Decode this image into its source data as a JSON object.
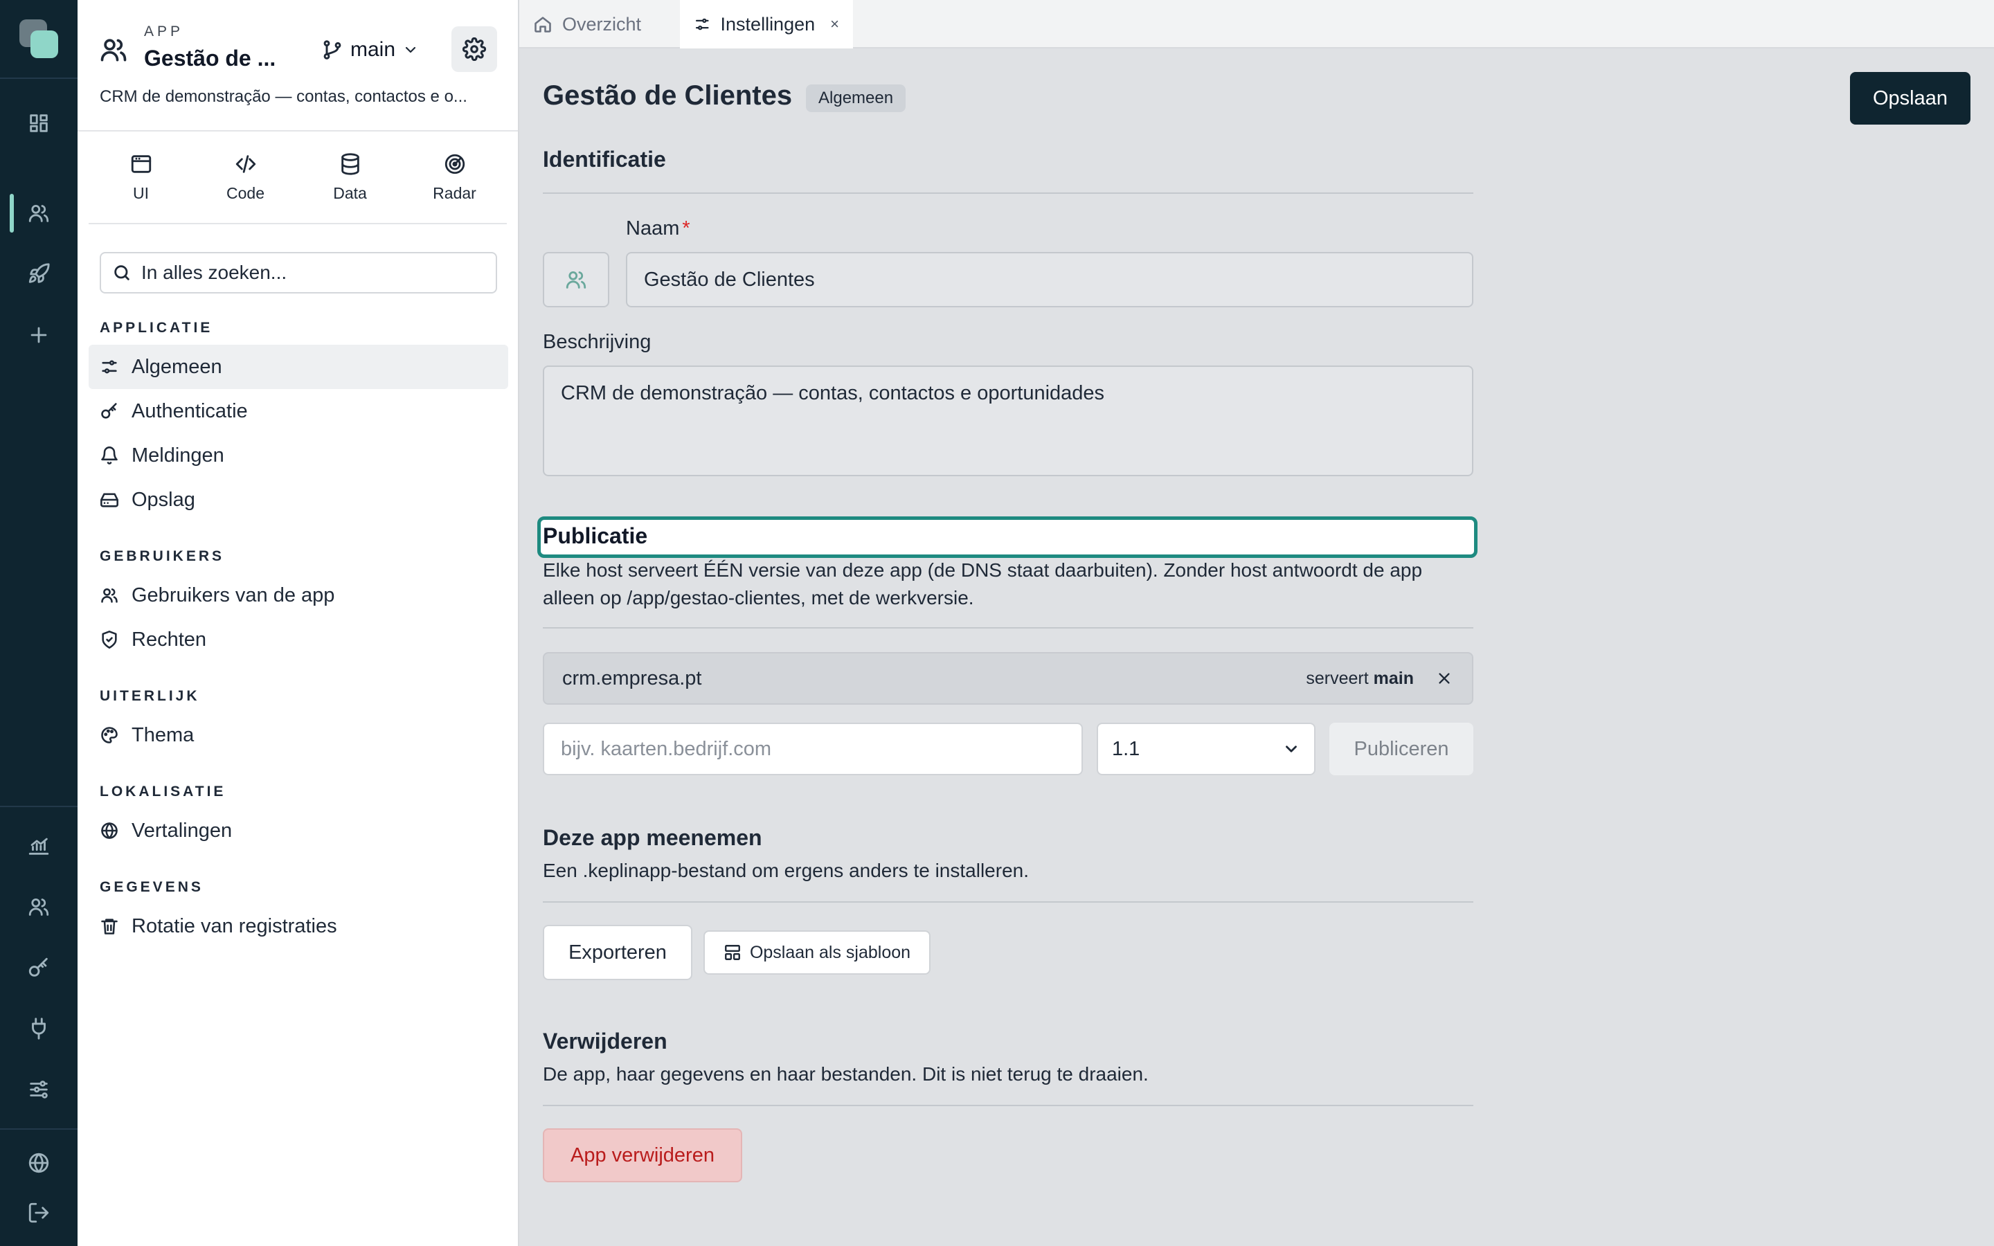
{
  "sidebar": {
    "app_label": "APP",
    "app_name": "Gestão de ...",
    "branch": "main",
    "app_description": "CRM de demonstração — contas, contactos e o...",
    "modes": [
      {
        "label": "UI",
        "icon": "window-icon"
      },
      {
        "label": "Code",
        "icon": "code-icon"
      },
      {
        "label": "Data",
        "icon": "database-icon"
      },
      {
        "label": "Radar",
        "icon": "radar-icon"
      }
    ],
    "search_placeholder": "In alles zoeken...",
    "groups": [
      {
        "label": "APPLICATIE",
        "items": [
          "Algemeen",
          "Authenticatie",
          "Meldingen",
          "Opslag"
        ]
      },
      {
        "label": "GEBRUIKERS",
        "items": [
          "Gebruikers van de app",
          "Rechten"
        ]
      },
      {
        "label": "UITERLIJK",
        "items": [
          "Thema"
        ]
      },
      {
        "label": "LOKALISATIE",
        "items": [
          "Vertalingen"
        ]
      },
      {
        "label": "GEGEVENS",
        "items": [
          "Rotatie van registraties"
        ]
      }
    ],
    "active_item": "Algemeen"
  },
  "tabs": [
    {
      "label": "Overzicht",
      "icon": "home-icon",
      "active": false
    },
    {
      "label": "Instellingen",
      "icon": "sliders-icon",
      "active": true,
      "close": "×"
    }
  ],
  "header": {
    "title": "Gestão de Clientes",
    "badge": "Algemeen",
    "save_label": "Opslaan"
  },
  "identification": {
    "title": "Identificatie",
    "name_label": "Naam",
    "name_required": "*",
    "name_value": "Gestão de Clientes",
    "description_label": "Beschrijving",
    "description_value": "CRM de demonstração — contas, contactos e oportunidades"
  },
  "publication": {
    "title": "Publicatie",
    "description": "Elke host serveert ÉÉN versie van deze app (de DNS staat daarbuiten). Zonder host antwoordt de app alleen op /app/gestao-clientes, met de werkversie.",
    "host": "crm.empresa.pt",
    "serves_prefix": "serveert",
    "serves_branch": "main",
    "new_host_placeholder": "bijv. kaarten.bedrijf.com",
    "version": "1.1",
    "publish_label": "Publiceren"
  },
  "export": {
    "title": "Deze app meenemen",
    "description": "Een .keplinapp-bestand om ergens anders te installeren.",
    "export_label": "Exporteren",
    "template_label": "Opslaan als sjabloon"
  },
  "delete": {
    "title": "Verwijderen",
    "description": "De app, haar gegevens en haar bestanden. Dit is niet terug te draaien.",
    "delete_label": "App verwijderen"
  },
  "colors": {
    "rail_bg": "#0f2530",
    "accent": "#1e8a80",
    "danger": "#b91c1c"
  }
}
